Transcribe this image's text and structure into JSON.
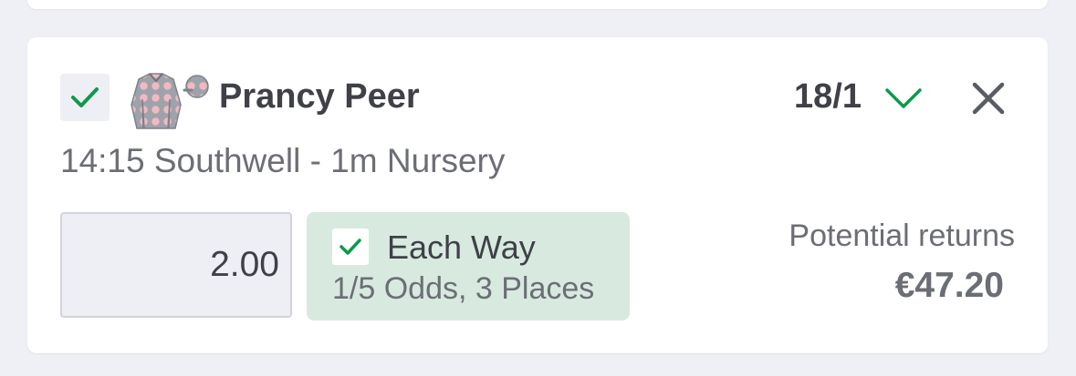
{
  "selection": {
    "checked": true,
    "runner_name": "Prancy Peer",
    "odds": "18/1",
    "event": "14:15 Southwell - 1m Nursery"
  },
  "stake": {
    "value": "2.00"
  },
  "each_way": {
    "checked": true,
    "label": "Each Way",
    "terms": "1/5 Odds, 3 Places"
  },
  "returns": {
    "label": "Potential returns",
    "value": "€47.20"
  },
  "icons": {
    "select": "check-icon",
    "silks": "jockey-silks-icon",
    "odds_trend": "chevron-down-icon",
    "remove": "close-icon"
  },
  "colors": {
    "accent_green": "#0b9a4a",
    "each_way_bg": "#d8eae0",
    "text_dark": "#3f4048",
    "text_muted": "#6c6e76",
    "silk_grey": "#9ea3ab",
    "silk_spots": "#f3b8c0"
  }
}
